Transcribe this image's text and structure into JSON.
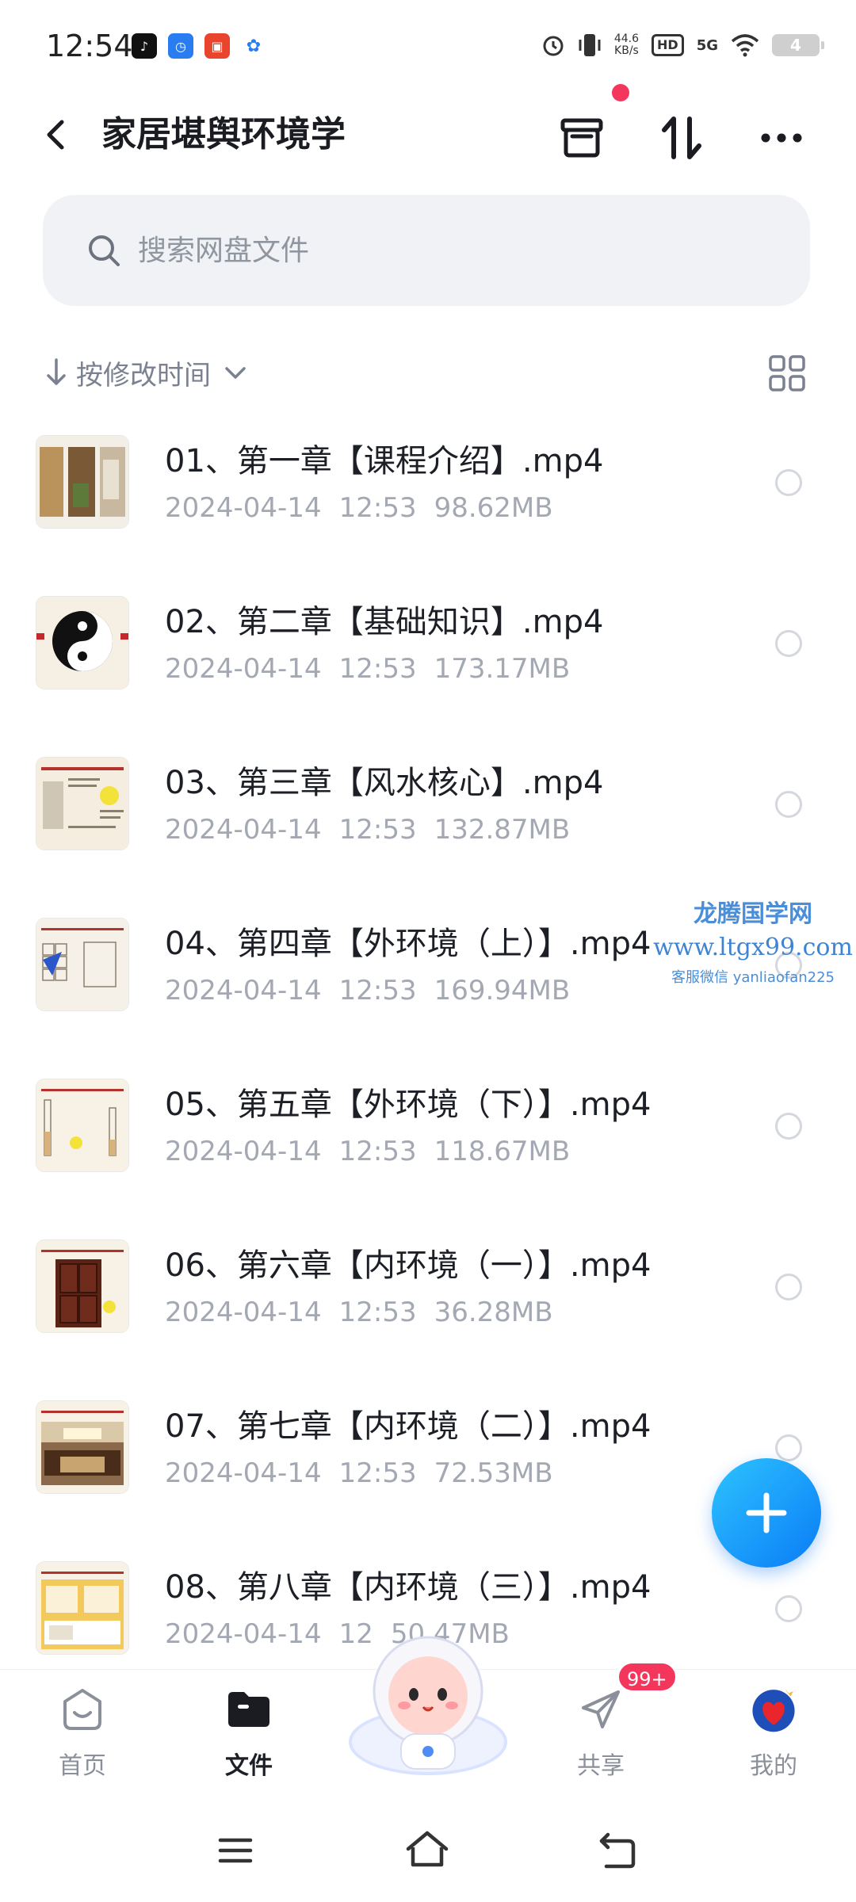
{
  "status_bar": {
    "time": "12:54",
    "net_speed_value": "44.6",
    "net_speed_unit": "KB/s",
    "hd_label": "HD",
    "signal_label": "5G",
    "battery_level": "4"
  },
  "header": {
    "title": "家居堪舆环境学"
  },
  "search": {
    "placeholder": "搜索网盘文件"
  },
  "sort": {
    "label": "按修改时间"
  },
  "files": [
    {
      "name": "01、第一章【课程介绍】.mp4",
      "date": "2024-04-14",
      "time": "12:53",
      "size": "98.62MB"
    },
    {
      "name": "02、第二章【基础知识】.mp4",
      "date": "2024-04-14",
      "time": "12:53",
      "size": "173.17MB"
    },
    {
      "name": "03、第三章【风水核心】.mp4",
      "date": "2024-04-14",
      "time": "12:53",
      "size": "132.87MB"
    },
    {
      "name": "04、第四章【外环境（上）】.mp4",
      "date": "2024-04-14",
      "time": "12:53",
      "size": "169.94MB"
    },
    {
      "name": "05、第五章【外环境（下）】.mp4",
      "date": "2024-04-14",
      "time": "12:53",
      "size": "118.67MB"
    },
    {
      "name": "06、第六章【内环境（一）】.mp4",
      "date": "2024-04-14",
      "time": "12:53",
      "size": "36.28MB"
    },
    {
      "name": "07、第七章【内环境（二）】.mp4",
      "date": "2024-04-14",
      "time": "12:53",
      "size": "72.53MB"
    },
    {
      "name": "08、第八章【内环境（三）】.mp4",
      "date": "2024-04-14",
      "time": "12",
      "size": "50.47MB"
    }
  ],
  "watermark": {
    "line1": "龙腾国学网",
    "line2": "www.ltgx99.com",
    "line3": "客服微信 yanliaofan225"
  },
  "bottom_nav": {
    "home": "首页",
    "files": "文件",
    "share": "共享",
    "mine": "我的",
    "share_badge": "99+"
  },
  "colors": {
    "accent": "#0a7cf6",
    "badge": "#f5365c"
  }
}
